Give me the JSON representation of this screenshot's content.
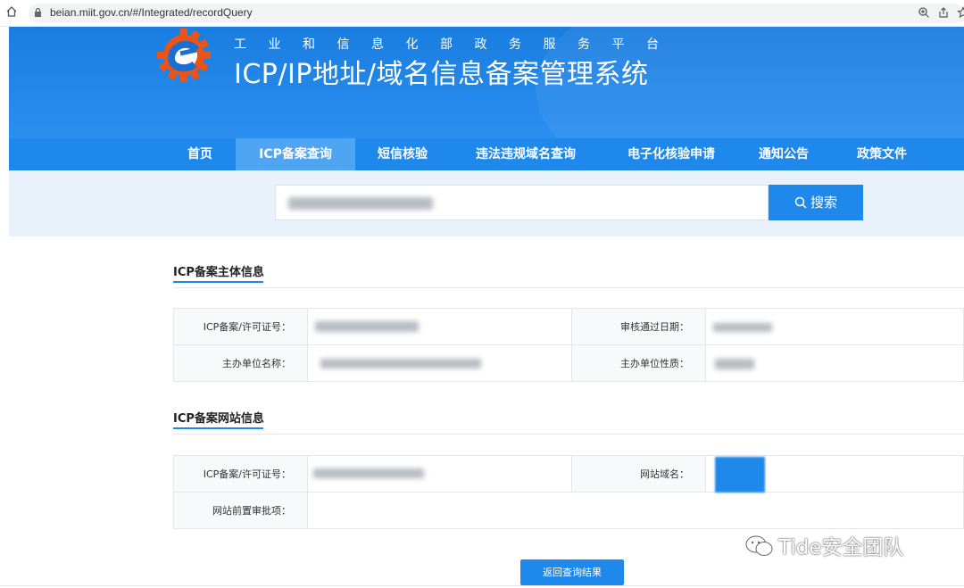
{
  "browser": {
    "url": "beian.miit.gov.cn/#/Integrated/recordQuery"
  },
  "header": {
    "subtitle": "工业和信息化部政务服务平台",
    "title": "ICP/IP地址/域名信息备案管理系统"
  },
  "nav": {
    "items": [
      {
        "label": "首页"
      },
      {
        "label": "ICP备案查询"
      },
      {
        "label": "短信核验"
      },
      {
        "label": "违法违规域名查询"
      },
      {
        "label": "电子化核验申请"
      },
      {
        "label": "通知公告"
      },
      {
        "label": "政策文件"
      }
    ],
    "active_index": 1
  },
  "search": {
    "button_label": "搜索"
  },
  "subject_section": {
    "title": "ICP备案主体信息",
    "row1_label_a": "ICP备案/许可证号：",
    "row1_label_b": "审核通过日期：",
    "row2_label_a": "主办单位名称：",
    "row2_label_b": "主办单位性质："
  },
  "site_section": {
    "title": "ICP备案网站信息",
    "row1_label_a": "ICP备案/许可证号：",
    "row1_label_b": "网站域名：",
    "row2_label_a": "网站前置审批项："
  },
  "return_button": "返回查询结果",
  "watermark": "Tide安全团队",
  "colors": {
    "primary": "#1f88eb",
    "header": "#1a7de0",
    "search_band": "#e9f2fb"
  }
}
